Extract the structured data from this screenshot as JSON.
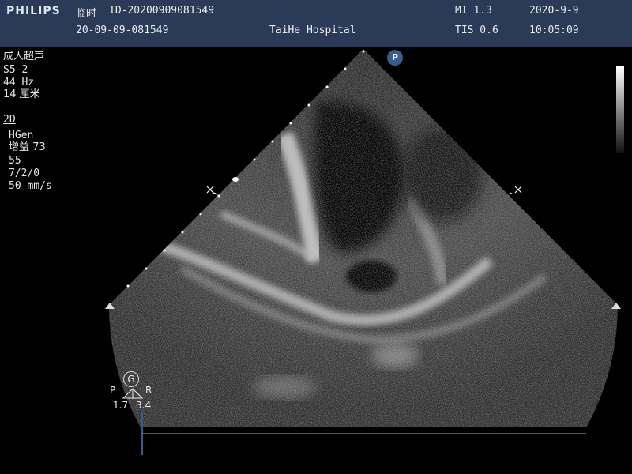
{
  "header": {
    "brand": "PHILIPS",
    "patient_prefix": "临时",
    "patient_id": "ID-20200909081549",
    "exam_id": "20-09-09-081549",
    "hospital": "TaiHe Hospital",
    "mi": "MI 1.3",
    "tis": "TIS 0.6",
    "date": "2020-9-9",
    "time": "10:05:09"
  },
  "settings": {
    "preset": "成人超声",
    "probe": "S5-2",
    "frame_rate": "44 Hz",
    "depth": "14 厘米",
    "mode": "2D",
    "gen": "HGen",
    "gain": "增益 73",
    "compression": "55",
    "persistence": "7/2/0",
    "sweep_speed": "50 mm/s"
  },
  "overlay": {
    "p_marker": "P",
    "g_marker": "G",
    "p_label": "P",
    "r_label": "R",
    "p_value": "1.7",
    "r_value": "3.4"
  },
  "colors": {
    "header_bg": "#2b3a57",
    "ecg_line": "#3fbf4a",
    "marker_blue": "#3a5b8f"
  }
}
